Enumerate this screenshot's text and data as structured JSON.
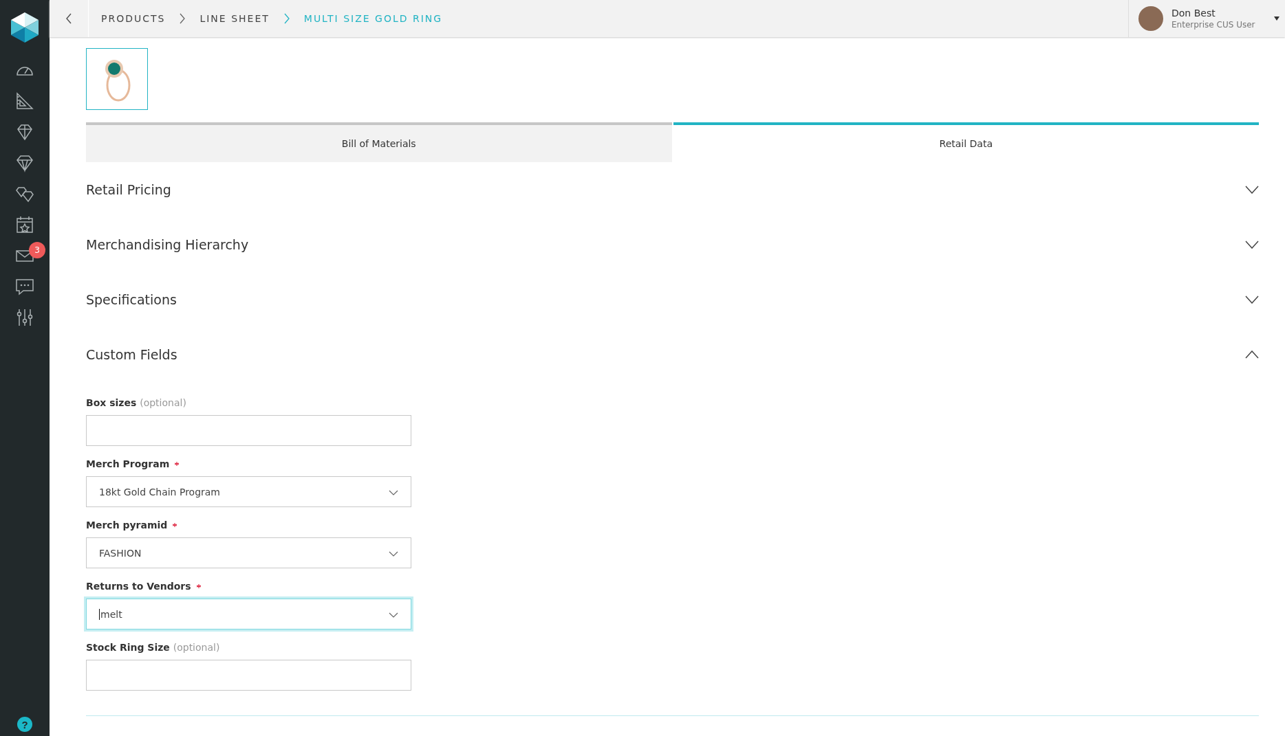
{
  "sidebar": {
    "items": [
      {
        "kind": "gauge"
      },
      {
        "kind": "ruler"
      },
      {
        "kind": "gem-grid"
      },
      {
        "kind": "gem"
      },
      {
        "kind": "gems"
      },
      {
        "kind": "calendar"
      },
      {
        "kind": "mail",
        "badge": "3"
      },
      {
        "kind": "chat"
      },
      {
        "kind": "sliders"
      }
    ],
    "help": "?"
  },
  "header": {
    "breadcrumbs": [
      {
        "label": "PRODUCTS",
        "selected": false
      },
      {
        "label": "LINE SHEET",
        "selected": false
      },
      {
        "label": "MULTI SIZE GOLD RING",
        "selected": true
      }
    ],
    "user": {
      "name": "Don Best",
      "role": "Enterprise CUS User"
    }
  },
  "tabs": [
    {
      "label": "Bill of Materials",
      "selected": false
    },
    {
      "label": "Retail Data",
      "selected": true
    }
  ],
  "sections": [
    {
      "title": "Retail Pricing",
      "expanded": false
    },
    {
      "title": "Merchandising Hierarchy",
      "expanded": false
    },
    {
      "title": "Specifications",
      "expanded": false
    },
    {
      "title": "Custom Fields",
      "expanded": true,
      "fields": [
        {
          "kind": "text",
          "label": "Box sizes",
          "optional": "(optional)",
          "required": false,
          "focused": false
        },
        {
          "kind": "select",
          "label": "Merch Program",
          "required": true,
          "value": "18kt Gold Chain Program",
          "focused": false
        },
        {
          "kind": "select",
          "label": "Merch pyramid",
          "required": true,
          "value": "FASHION",
          "focused": false
        },
        {
          "kind": "select",
          "label": "Returns to Vendors",
          "required": true,
          "value": "melt",
          "focused": true
        },
        {
          "kind": "text",
          "label": "Stock Ring Size",
          "optional": "(optional)",
          "required": false,
          "focused": false
        }
      ]
    }
  ]
}
